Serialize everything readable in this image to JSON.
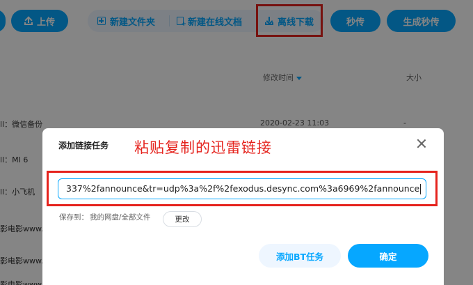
{
  "toolbar": {
    "upload_label": "上传",
    "new_folder_label": "新建文件夹",
    "new_online_doc_label": "新建在线文档",
    "offline_download_label": "离线下载",
    "instant_transfer_label": "秒传",
    "generate_instant_label": "生成秒传"
  },
  "table": {
    "col_modified": "修改时间",
    "col_size": "大小",
    "rows": [
      {
        "name": "ll：微信备份",
        "time": "2020-02-23 11:03",
        "size": "-"
      },
      {
        "name": "ll：MI 6",
        "time": "",
        "size": ""
      },
      {
        "name": "ll：小飞机",
        "time": "",
        "size": ""
      },
      {
        "name": "影电影www.y",
        "time": "",
        "size": ""
      },
      {
        "name": "影电影www.y",
        "time": "",
        "size": ""
      },
      {
        "name": "影电影www.y",
        "time": "",
        "size": ""
      }
    ]
  },
  "dialog": {
    "title": "添加链接任务",
    "annotation": "粘贴复制的迅雷链接",
    "link_value": "337%2fannounce&tr=udp%3a%2f%2fexodus.desync.com%3a6969%2fannounce",
    "save_to_label": "保存到：",
    "save_path": "我的网盘/全部文件",
    "change_label": "更改",
    "add_bt_label": "添加BT任务",
    "confirm_label": "确定"
  },
  "colors": {
    "accent": "#06a7ff",
    "annotation_red": "#e5231d",
    "overlay": "rgba(0,0,0,0.48)"
  }
}
